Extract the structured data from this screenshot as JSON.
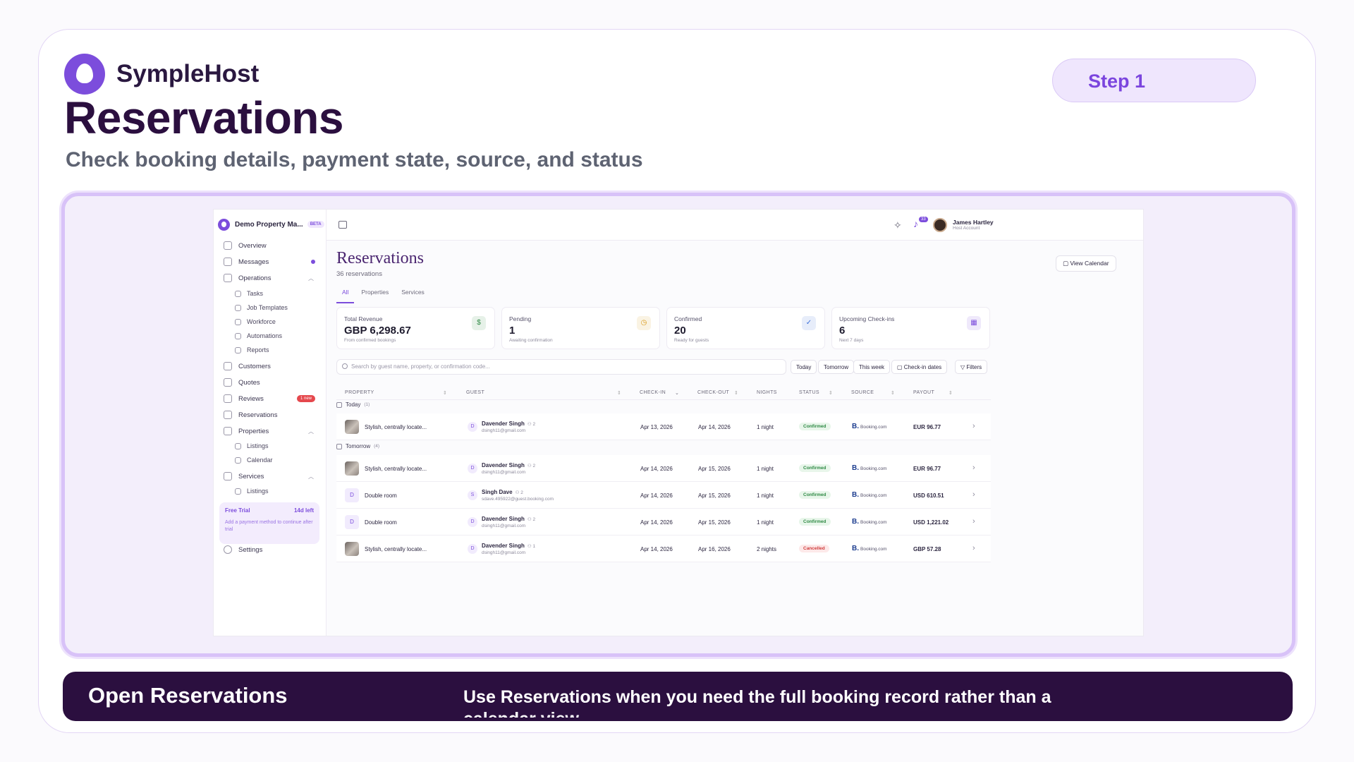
{
  "brand": {
    "name": "SympleHost"
  },
  "header": {
    "title": "Reservations",
    "subtitle": "Check booking details, payment state, source, and status",
    "step": "Step 1"
  },
  "app": {
    "sidebar": {
      "property": "Demo Property Ma...",
      "badge": "BETA",
      "items": {
        "overview": "Overview",
        "messages": "Messages",
        "operations": "Operations",
        "tasks": "Tasks",
        "job_templates": "Job Templates",
        "workforce": "Workforce",
        "automations": "Automations",
        "reports": "Reports",
        "customers": "Customers",
        "quotes": "Quotes",
        "reviews": "Reviews",
        "reviews_badge": "1 new",
        "reservations": "Reservations",
        "properties": "Properties",
        "prop_listings": "Listings",
        "calendar": "Calendar",
        "services": "Services",
        "svc_listings": "Listings",
        "settings": "Settings"
      },
      "trial": {
        "label": "Free Trial",
        "days": "14d left",
        "message": "Add a payment method to continue after trial"
      }
    },
    "topbar": {
      "notifications": "33",
      "user_name": "James Hartley",
      "user_role": "Host Account"
    },
    "page": {
      "title": "Reservations",
      "count": "36 reservations",
      "view_calendar": "View Calendar",
      "tabs": [
        "All",
        "Properties",
        "Services"
      ]
    },
    "stats": [
      {
        "label": "Total Revenue",
        "value": "GBP 6,298.67",
        "sub": "From confirmed bookings",
        "icon": "dollar-icon",
        "color": "#2f8a45"
      },
      {
        "label": "Pending",
        "value": "1",
        "sub": "Awaiting confirmation",
        "icon": "clock-icon",
        "color": "#d99a1a"
      },
      {
        "label": "Confirmed",
        "value": "20",
        "sub": "Ready for guests",
        "icon": "check-circle-icon",
        "color": "#3b6fd9"
      },
      {
        "label": "Upcoming Check-ins",
        "value": "6",
        "sub": "Next 7 days",
        "icon": "calendar-icon",
        "color": "#7c4ddc"
      }
    ],
    "search": {
      "placeholder": "Search by guest name, property, or confirmation code..."
    },
    "filters": {
      "today": "Today",
      "tomorrow": "Tomorrow",
      "week": "This week",
      "checkin": "Check-in dates",
      "filters": "Filters"
    },
    "columns": [
      "PROPERTY",
      "GUEST",
      "CHECK-IN",
      "CHECK-OUT",
      "NIGHTS",
      "STATUS",
      "SOURCE",
      "PAYOUT"
    ],
    "groups": [
      {
        "label": "Today",
        "count": "(1)"
      },
      {
        "label": "Tomorrow",
        "count": "(4)"
      }
    ],
    "rows": [
      {
        "property": "Stylish, centrally locate...",
        "initial": "",
        "guest_initial": "D",
        "guest": "Davender Singh",
        "party": "2",
        "email": "dsingh11@gmail.com",
        "checkin": "Apr 13, 2026",
        "checkout": "Apr 14, 2026",
        "nights": "1 night",
        "status": "Confirmed",
        "source_mark": "B.",
        "source": "Booking.com",
        "payout": "EUR 96.77"
      },
      {
        "property": "Stylish, centrally locate...",
        "initial": "",
        "guest_initial": "D",
        "guest": "Davender Singh",
        "party": "2",
        "email": "dsingh11@gmail.com",
        "checkin": "Apr 14, 2026",
        "checkout": "Apr 15, 2026",
        "nights": "1 night",
        "status": "Confirmed",
        "source_mark": "B.",
        "source": "Booking.com",
        "payout": "EUR 96.77"
      },
      {
        "property": "Double room",
        "initial": "D",
        "guest_initial": "S",
        "guest": "Singh Dave",
        "party": "2",
        "email": "sdave.495922@guest.booking.com",
        "checkin": "Apr 14, 2026",
        "checkout": "Apr 15, 2026",
        "nights": "1 night",
        "status": "Confirmed",
        "source_mark": "B.",
        "source": "Booking.com",
        "payout": "USD 610.51"
      },
      {
        "property": "Double room",
        "initial": "D",
        "guest_initial": "D",
        "guest": "Davender Singh",
        "party": "2",
        "email": "dsingh11@gmail.com",
        "checkin": "Apr 14, 2026",
        "checkout": "Apr 15, 2026",
        "nights": "1 night",
        "status": "Confirmed",
        "source_mark": "B.",
        "source": "Booking.com",
        "payout": "USD 1,221.02"
      },
      {
        "property": "Stylish, centrally locate...",
        "initial": "",
        "guest_initial": "D",
        "guest": "Davender Singh",
        "party": "1",
        "email": "dsingh11@gmail.com",
        "checkin": "Apr 14, 2026",
        "checkout": "Apr 16, 2026",
        "nights": "2 nights",
        "status": "Cancelled",
        "source_mark": "B.",
        "source": "Booking.com",
        "payout": "GBP 57.28"
      }
    ]
  },
  "banner": {
    "title": "Open Reservations",
    "text": "Use Reservations when you need the full booking record rather than a calendar view."
  }
}
